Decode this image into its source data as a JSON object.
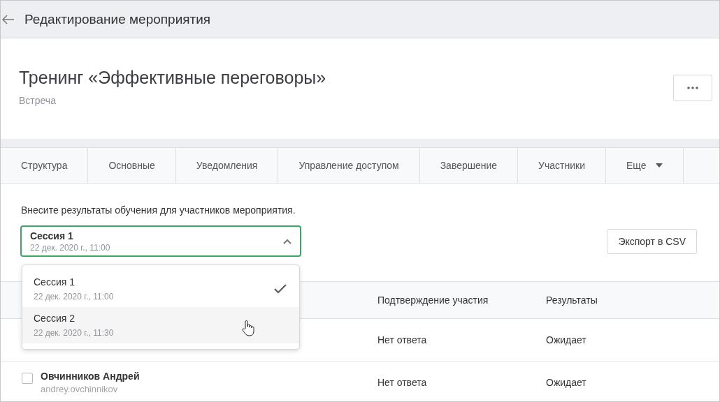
{
  "header": {
    "title": "Редактирование мероприятия"
  },
  "event": {
    "title": "Тренинг «Эффективные переговоры»",
    "type": "Встреча"
  },
  "tabs": [
    {
      "label": "Структура",
      "selected": false
    },
    {
      "label": "Основные",
      "selected": false
    },
    {
      "label": "Уведомления",
      "selected": false
    },
    {
      "label": "Управление доступом",
      "selected": false
    },
    {
      "label": "Завершение",
      "selected": false
    },
    {
      "label": "Участники",
      "selected": false
    },
    {
      "label": "Еще",
      "selected": false,
      "kind": "menu"
    }
  ],
  "intro": "Внесите результаты обучения для участников мероприятия.",
  "session_select": {
    "value": "Сессия 1",
    "date": "22 дек. 2020 г., 11:00",
    "expanded": true,
    "options": [
      {
        "label": "Сессия 1",
        "date": "22 дек. 2020 г., 11:00",
        "selected": true,
        "hovered": false
      },
      {
        "label": "Сессия 2",
        "date": "22 дек. 2020 г., 11:30",
        "selected": false,
        "hovered": true
      }
    ]
  },
  "export_button": "Экспорт в CSV",
  "table": {
    "columns": [
      "Подтверждение участия",
      "Результаты"
    ],
    "rows": [
      {
        "confirmation": "Нет ответа",
        "result": "Ожидает"
      },
      {
        "name": "Овчинников Андрей",
        "login": "andrey.ovchinnikov",
        "checked": false,
        "confirmation": "Нет ответа",
        "result": "Ожидает"
      }
    ]
  }
}
